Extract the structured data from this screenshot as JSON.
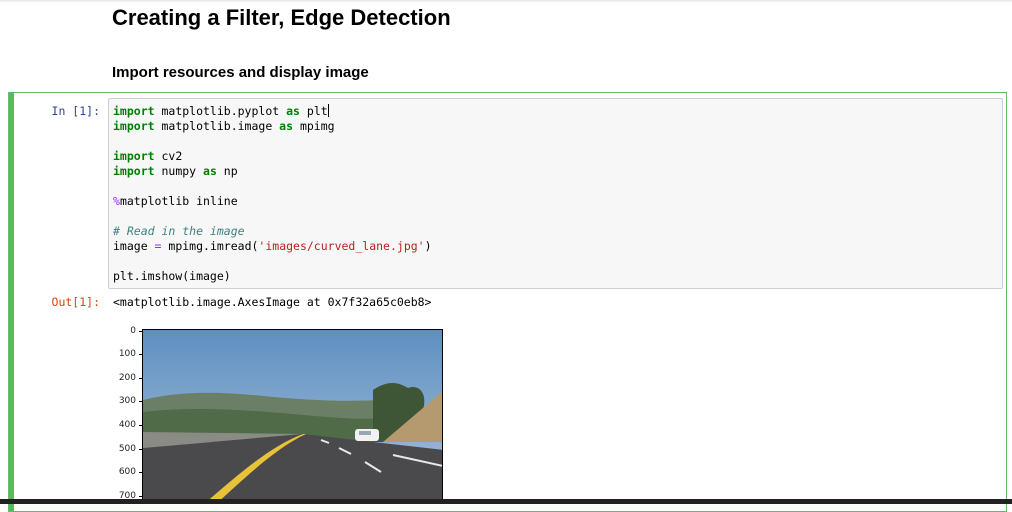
{
  "headings": {
    "title": "Creating a Filter, Edge Detection",
    "subtitle": "Import resources and display image"
  },
  "cell": {
    "in_prompt": "In [1]:",
    "out_prompt": "Out[1]:",
    "output_text": "<matplotlib.image.AxesImage at 0x7f32a65c0eb8>"
  },
  "code": {
    "l1": {
      "kw1": "import",
      "t1": " matplotlib.pyplot ",
      "kw2": "as",
      "t2": " plt"
    },
    "l2": {
      "kw1": "import",
      "t1": " matplotlib.image ",
      "kw2": "as",
      "t2": " mpimg"
    },
    "l4": {
      "kw1": "import",
      "t1": " cv2"
    },
    "l5": {
      "kw1": "import",
      "t1": " numpy ",
      "kw2": "as",
      "t2": " np"
    },
    "l7": {
      "magic": "%",
      "t1": "matplotlib inline"
    },
    "l9": {
      "comment": "# Read in the image"
    },
    "l10": {
      "t1": "image ",
      "op": "=",
      "t2": " mpimg.imread(",
      "str": "'images/curved_lane.jpg'",
      "t3": ")"
    },
    "l12": {
      "t1": "plt.imshow(image)"
    }
  },
  "plot": {
    "yticks": [
      "0",
      "100",
      "200",
      "300",
      "400",
      "500",
      "600",
      "700"
    ],
    "image_subject": "curved highway lane with hills and a white car",
    "colors": {
      "sky": "#5f8fc0",
      "road": "#4a4a4c",
      "hills": "#4f6b48",
      "dry_slope": "#b49a6e",
      "lane_yellow": "#e8c238"
    }
  }
}
